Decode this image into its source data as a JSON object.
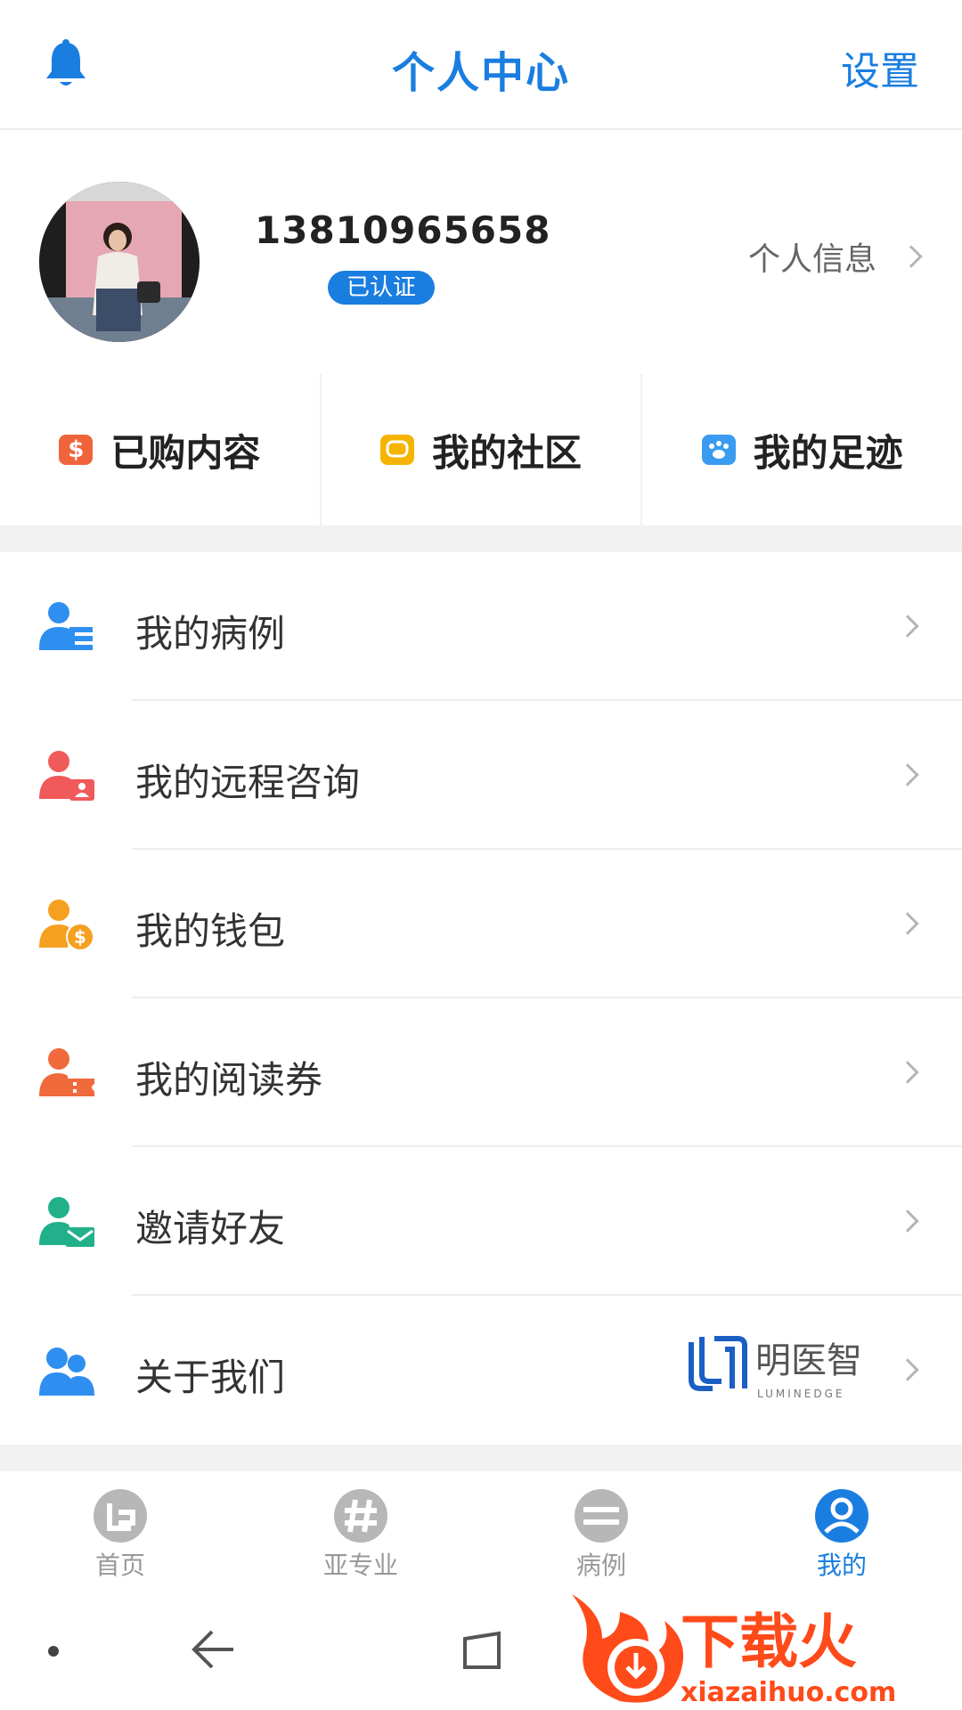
{
  "header": {
    "title": "个人中心",
    "settings_label": "设置",
    "bell_icon": "bell-icon"
  },
  "profile": {
    "phone": "13810965658",
    "verified_label": "已认证",
    "personal_info_label": "个人信息"
  },
  "quick_links": [
    {
      "label": "已购内容",
      "icon": "purchased-icon",
      "color": "#f0643c"
    },
    {
      "label": "我的社区",
      "icon": "community-icon",
      "color": "#f5b400"
    },
    {
      "label": "我的足迹",
      "icon": "footprint-icon",
      "color": "#3a9cf0"
    }
  ],
  "menu": [
    {
      "label": "我的病例",
      "icon": "cases-icon",
      "color": "#2f8ff0"
    },
    {
      "label": "我的远程咨询",
      "icon": "remote-consult-icon",
      "color": "#f05a5a"
    },
    {
      "label": "我的钱包",
      "icon": "wallet-icon",
      "color": "#f5a020"
    },
    {
      "label": "我的阅读券",
      "icon": "reading-voucher-icon",
      "color": "#f06a3c"
    },
    {
      "label": "邀请好友",
      "icon": "invite-friends-icon",
      "color": "#22b08a"
    },
    {
      "label": "关于我们",
      "icon": "about-us-icon",
      "color": "#2f8ff0"
    }
  ],
  "brand": {
    "name": "明医智",
    "sub": "LUMINEDGE"
  },
  "tabs": [
    {
      "label": "首页",
      "icon": "home-icon"
    },
    {
      "label": "亚专业",
      "icon": "subspecialty-icon"
    },
    {
      "label": "病例",
      "icon": "cases-tab-icon"
    },
    {
      "label": "我的",
      "icon": "profile-tab-icon",
      "active": true
    }
  ],
  "watermark": {
    "text": "下载火",
    "url": "xiazaihuo.com"
  },
  "colors": {
    "accent": "#1a7ee0",
    "inactive": "#999999"
  }
}
